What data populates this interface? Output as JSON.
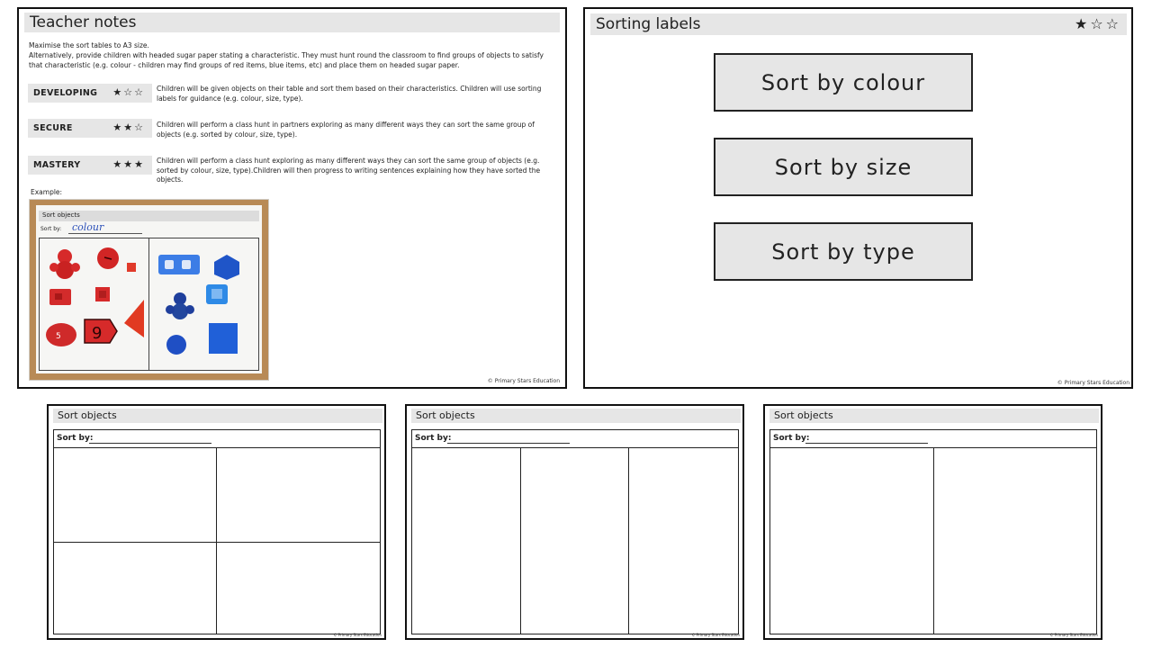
{
  "teacher_notes": {
    "title": "Teacher notes",
    "intro_line1": "Maximise the sort tables to A3 size.",
    "intro_line2": "Alternatively, provide children with headed sugar paper stating a characteristic. They must hunt round the classroom to find groups of objects to satisfy that characteristic (e.g. colour - children may find groups of red items, blue items, etc) and place them on headed sugar paper.",
    "levels": [
      {
        "name": "DEVELOPING",
        "stars": "★☆☆",
        "description": "Children will be given objects on their table and sort them based on their characteristics. Children will use sorting labels for guidance (e.g. colour, size, type)."
      },
      {
        "name": "SECURE",
        "stars": "★★☆",
        "description": "Children will perform a class hunt in partners exploring as many different ways they can sort the same group of objects (e.g. sorted by colour, size, type)."
      },
      {
        "name": "MASTERY",
        "stars": "★★★",
        "description": "Children will perform a class hunt exploring as many different ways they can sort the same group of objects (e.g. sorted by colour, size, type).Children will then progress to writing sentences explaining how they have sorted the objects."
      }
    ],
    "example_label": "Example:",
    "photo": {
      "sheet_title": "Sort objects",
      "sort_by_label": "Sort by:",
      "handwritten_word": "colour"
    },
    "footer": "© Primary Stars Education"
  },
  "sorting_labels": {
    "title": "Sorting labels",
    "header_stars": "★☆☆",
    "labels": [
      "Sort by colour",
      "Sort by size",
      "Sort by type"
    ],
    "footer": "© Primary Stars Education"
  },
  "templates": [
    {
      "title": "Sort objects",
      "sort_by_label": "Sort by:",
      "layout": "2x2",
      "footer": "© Primary Stars Education"
    },
    {
      "title": "Sort objects",
      "sort_by_label": "Sort by:",
      "layout": "3 columns",
      "footer": "© Primary Stars Education"
    },
    {
      "title": "Sort objects",
      "sort_by_label": "Sort by:",
      "layout": "2 columns",
      "footer": "© Primary Stars Education"
    }
  ],
  "colors": {
    "header_gray": "#e6e6e6",
    "border": "#111111",
    "red_objects": "#d62a2a",
    "blue_objects": "#2b6ee0"
  }
}
